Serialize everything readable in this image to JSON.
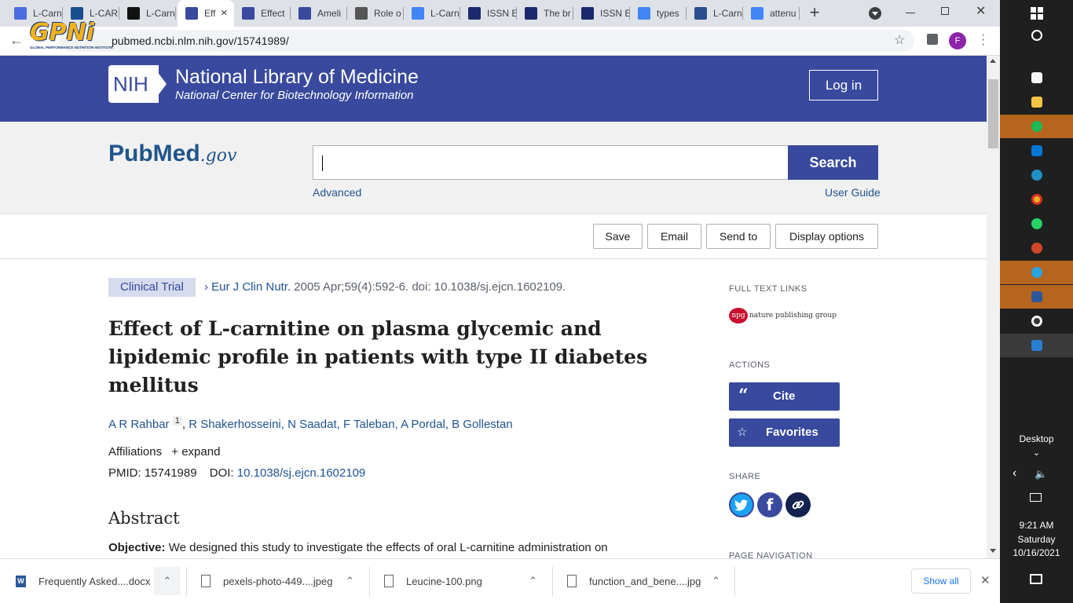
{
  "browser": {
    "tabs": [
      {
        "label": "L-Carn",
        "icon": "docs-icon",
        "color": "#4a6ee0"
      },
      {
        "label": "L-CAR",
        "icon": "webmd-icon",
        "color": "#1a4d8f"
      },
      {
        "label": "L-Carn",
        "icon": "notion-icon",
        "color": "#111111"
      },
      {
        "label": "Eff",
        "icon": "pubmed-icon",
        "color": "#38499e"
      },
      {
        "label": "Effect",
        "icon": "pubmed-icon",
        "color": "#38499e"
      },
      {
        "label": "Ameli",
        "icon": "pubmed-icon",
        "color": "#38499e"
      },
      {
        "label": "Role o",
        "icon": "link-icon",
        "color": "#555555"
      },
      {
        "label": "L-Carn",
        "icon": "google-icon",
        "color": "#4285f4"
      },
      {
        "label": "ISSN E",
        "icon": "issn-icon",
        "color": "#1b2a6b"
      },
      {
        "label": "The br",
        "icon": "issn-icon",
        "color": "#1b2a6b"
      },
      {
        "label": "ISSN E",
        "icon": "issn-icon",
        "color": "#1b2a6b"
      },
      {
        "label": "types",
        "icon": "google-icon",
        "color": "#4285f4"
      },
      {
        "label": "L-Carn",
        "icon": "nature-icon",
        "color": "#2a4e8c"
      },
      {
        "label": "attenu",
        "icon": "google-icon",
        "color": "#4285f4"
      }
    ],
    "url": "pubmed.ncbi.nlm.nih.gov/15741989/",
    "logo_text": "GPNi",
    "logo_sub": "GLOBAL PERFORMANCE NUTRITION INSTITUTE",
    "profile_initial": "F"
  },
  "nih": {
    "badge": "NIH",
    "title": "National Library of Medicine",
    "subtitle": "National Center for Biotechnology Information",
    "login": "Log in"
  },
  "search": {
    "logo_pub": "Pub",
    "logo_med": "Med",
    "logo_gov": ".gov",
    "button": "Search",
    "advanced": "Advanced",
    "user_guide": "User Guide",
    "value": ""
  },
  "actionsbar": {
    "save": "Save",
    "email": "Email",
    "send_to": "Send to",
    "display": "Display options"
  },
  "article": {
    "type": "Clinical Trial",
    "journal": "Eur J Clin Nutr.",
    "citation": "2005 Apr;59(4):592-6. doi: 10.1038/sj.ejcn.1602109.",
    "title_lines": [
      "Effect of L-carnitine on plasma glycemic and",
      "lipidemic profile in patients with type II diabetes",
      "mellitus"
    ],
    "first_author": "A R Rahbar",
    "first_author_sup": "1",
    "other_authors": "R Shakerhosseini, N Saadat, F Taleban, A Pordal, B Gollestan",
    "affiliations": "Affiliations",
    "expand": "expand",
    "pmid_label": "PMID:",
    "pmid": "15741989",
    "doi_label": "DOI:",
    "doi": "10.1038/sj.ejcn.1602109",
    "abstract_heading": "Abstract",
    "objective_label": "Objective:",
    "objective_text": "We designed this study to investigate the effects of oral L-carnitine administration on"
  },
  "sidebar": {
    "full_text": "FULL TEXT LINKS",
    "npg": "npg",
    "npg_text": "nature publishing group",
    "actions": "ACTIONS",
    "cite": "Cite",
    "favorites": "Favorites",
    "share": "SHARE",
    "page_nav": "PAGE NAVIGATION"
  },
  "downloads": {
    "items": [
      {
        "name": "Frequently Asked....docx"
      },
      {
        "name": "pexels-photo-449....jpeg"
      },
      {
        "name": "Leucine-100.png"
      },
      {
        "name": "function_and_bene....jpg"
      }
    ],
    "show_all": "Show all"
  },
  "taskbar": {
    "desktop": "Desktop",
    "time": "9:21 AM",
    "day": "Saturday",
    "date": "10/16/2021"
  }
}
